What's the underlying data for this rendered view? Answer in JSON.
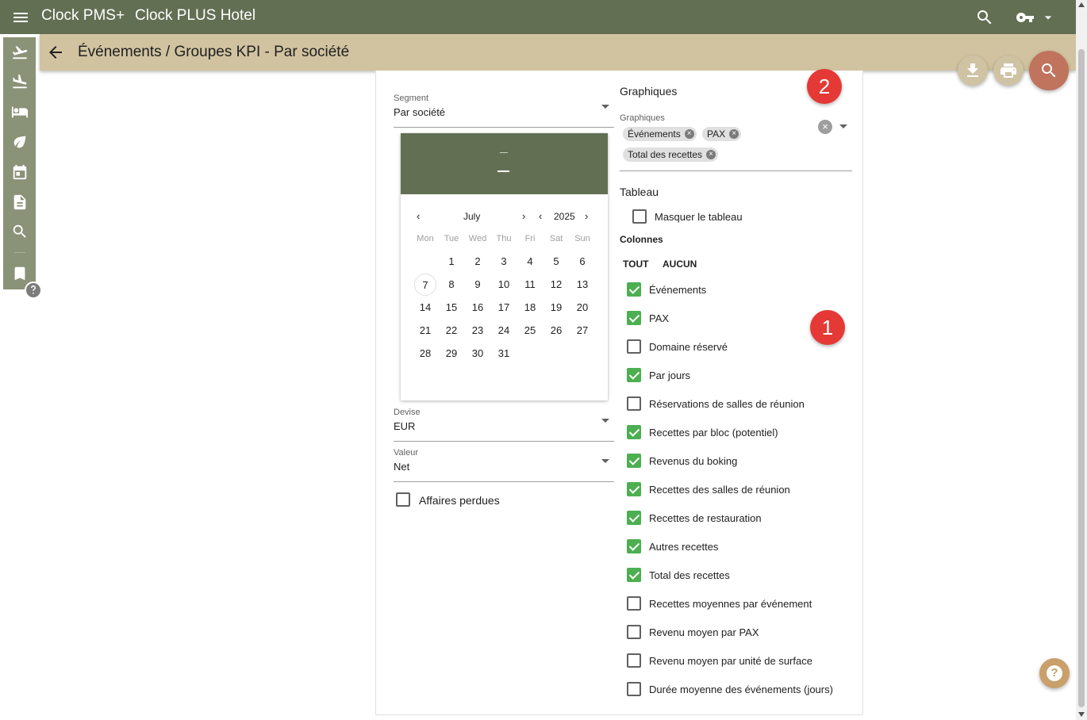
{
  "app": {
    "name": "Clock PMS+",
    "hotel": "Clock PLUS Hotel"
  },
  "page": {
    "title": "Événements / Groupes KPI - Par société"
  },
  "icons": {
    "menu": "hamburger-menu-icon",
    "search": "search-icon",
    "key": "key-icon",
    "back": "arrow-left-icon",
    "download": "download-icon",
    "print": "print-icon"
  },
  "leftnav": [
    {
      "icon": "arrivals-icon"
    },
    {
      "icon": "departures-icon"
    },
    {
      "icon": "bed-icon"
    },
    {
      "icon": "leaf-icon"
    },
    {
      "icon": "calendar-icon"
    },
    {
      "icon": "document-icon"
    },
    {
      "icon": "search-icon"
    },
    {
      "icon": "bookmark-icon"
    }
  ],
  "form": {
    "segment": {
      "label": "Segment",
      "value": "Par société"
    },
    "devise": {
      "label": "Devise",
      "value": "EUR"
    },
    "valeur": {
      "label": "Valeur",
      "value": "Net"
    },
    "lost_business": {
      "label": "Affaires perdues",
      "checked": false
    }
  },
  "calendar": {
    "month": "July",
    "year": "2025",
    "weekdays": [
      "Mon",
      "Tue",
      "Wed",
      "Thu",
      "Fri",
      "Sat",
      "Sun"
    ],
    "today": "7",
    "weeks": [
      [
        "",
        "1",
        "2",
        "3",
        "4",
        "5",
        "6"
      ],
      [
        "7",
        "8",
        "9",
        "10",
        "11",
        "12",
        "13"
      ],
      [
        "14",
        "15",
        "16",
        "17",
        "18",
        "19",
        "20"
      ],
      [
        "21",
        "22",
        "23",
        "24",
        "25",
        "26",
        "27"
      ],
      [
        "28",
        "29",
        "30",
        "31",
        "",
        "",
        ""
      ]
    ]
  },
  "graphs": {
    "title": "Graphiques",
    "field_label": "Graphiques",
    "chips": [
      "Événements",
      "PAX",
      "Total des recettes"
    ]
  },
  "table": {
    "title": "Tableau",
    "hide_label": "Masquer le tableau",
    "hide_checked": false,
    "columns_label": "Colonnes",
    "all_label": "TOUT",
    "none_label": "AUCUN",
    "columns": [
      {
        "label": "Événements",
        "checked": true
      },
      {
        "label": "PAX",
        "checked": true
      },
      {
        "label": "Domaine réservé",
        "checked": false
      },
      {
        "label": "Par jours",
        "checked": true
      },
      {
        "label": "Réservations de salles de réunion",
        "checked": false
      },
      {
        "label": "Recettes par bloc (potentiel)",
        "checked": true
      },
      {
        "label": "Revenus du boking",
        "checked": true
      },
      {
        "label": "Recettes des salles de réunion",
        "checked": true
      },
      {
        "label": "Recettes de restauration",
        "checked": true
      },
      {
        "label": "Autres recettes",
        "checked": true
      },
      {
        "label": "Total des recettes",
        "checked": true
      },
      {
        "label": "Recettes moyennes par événement",
        "checked": false
      },
      {
        "label": "Revenu moyen par PAX",
        "checked": false
      },
      {
        "label": "Revenu moyen par unité de surface",
        "checked": false
      },
      {
        "label": "Durée moyenne des événements (jours)",
        "checked": false
      }
    ]
  },
  "badges": [
    "1",
    "2"
  ],
  "help": "?"
}
